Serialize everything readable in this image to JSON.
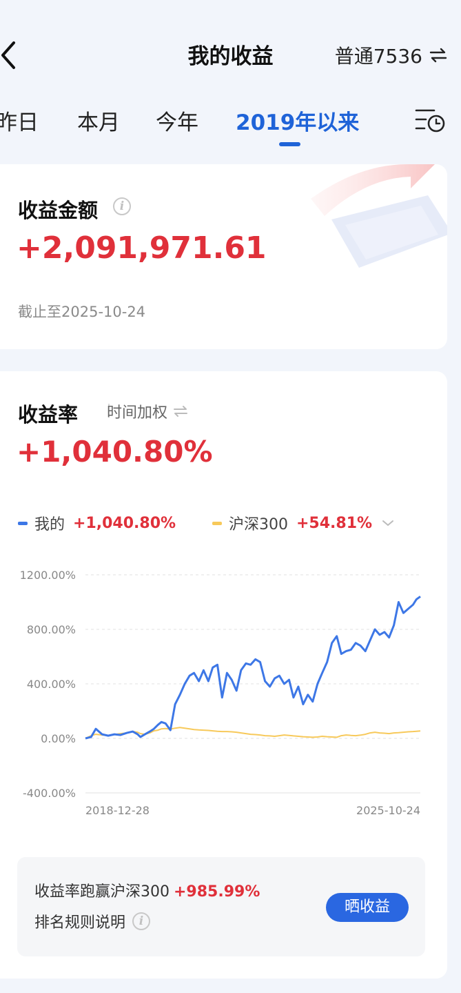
{
  "header": {
    "title": "我的收益",
    "account": "普通7536"
  },
  "tabs": [
    "昨日",
    "本月",
    "今年",
    "2019年以来"
  ],
  "active_tab": 3,
  "profit_amount": {
    "label": "收益金额",
    "value": "+2,091,971.61",
    "as_of": "截止至2025-10-24"
  },
  "return_rate": {
    "label": "收益率",
    "mode": "时间加权",
    "value": "+1,040.80%"
  },
  "legend": {
    "mine": {
      "label": "我的",
      "value": "+1,040.80%",
      "color": "#3d77e6"
    },
    "index": {
      "label": "沪深300",
      "value": "+54.81%",
      "color": "#f7c95a"
    }
  },
  "chart_data": {
    "type": "line",
    "y_ticks": [
      "1200.00%",
      "800.00%",
      "400.00%",
      "0.00%",
      "-400.00%"
    ],
    "ylim": [
      -400,
      1200
    ],
    "x_start_label": "2018-12-28",
    "x_end_label": "2025-10-24",
    "x": [
      "2018-12-28",
      "2019-02-08",
      "2019-03-15",
      "2019-05-01",
      "2019-06-15",
      "2019-08-01",
      "2019-09-15",
      "2019-11-01",
      "2019-12-15",
      "2020-01-20",
      "2020-02-10",
      "2020-03-15",
      "2020-04-20",
      "2020-05-20",
      "2020-06-20",
      "2020-07-15",
      "2020-08-15",
      "2020-09-20",
      "2020-10-25",
      "2020-11-30",
      "2021-01-05",
      "2021-02-10",
      "2021-03-15",
      "2021-04-20",
      "2021-05-25",
      "2021-06-30",
      "2021-08-01",
      "2021-09-05",
      "2021-10-10",
      "2021-11-15",
      "2021-12-20",
      "2022-01-25",
      "2022-02-28",
      "2022-04-05",
      "2022-05-10",
      "2022-06-15",
      "2022-07-20",
      "2022-08-25",
      "2022-09-30",
      "2022-11-05",
      "2022-12-10",
      "2023-01-15",
      "2023-02-20",
      "2023-03-25",
      "2023-04-30",
      "2023-06-05",
      "2023-07-10",
      "2023-08-15",
      "2023-09-20",
      "2023-10-25",
      "2023-11-30",
      "2024-01-05",
      "2024-02-10",
      "2024-03-15",
      "2024-04-20",
      "2024-05-25",
      "2024-06-30",
      "2024-08-05",
      "2024-09-10",
      "2024-10-15",
      "2024-11-20",
      "2024-12-25",
      "2025-01-30",
      "2025-03-05",
      "2025-04-10",
      "2025-05-15",
      "2025-06-20",
      "2025-07-25",
      "2025-08-30",
      "2025-09-25",
      "2025-10-24"
    ],
    "series": [
      {
        "name": "我的",
        "color": "#3d77e6",
        "values": [
          0,
          10,
          70,
          30,
          20,
          30,
          25,
          40,
          50,
          30,
          10,
          30,
          50,
          70,
          100,
          120,
          110,
          60,
          250,
          320,
          400,
          460,
          480,
          420,
          500,
          420,
          520,
          540,
          300,
          480,
          430,
          350,
          500,
          550,
          540,
          580,
          560,
          420,
          380,
          440,
          460,
          400,
          430,
          300,
          380,
          250,
          320,
          270,
          400,
          480,
          560,
          700,
          750,
          620,
          640,
          650,
          700,
          680,
          640,
          720,
          800,
          760,
          780,
          740,
          830,
          1000,
          920,
          950,
          980,
          1020,
          1040.8
        ]
      },
      {
        "name": "沪深300",
        "color": "#f7c95a",
        "values": [
          0,
          20,
          30,
          25,
          22,
          28,
          35,
          40,
          50,
          45,
          35,
          30,
          40,
          55,
          60,
          70,
          72,
          68,
          75,
          80,
          75,
          70,
          65,
          62,
          60,
          58,
          55,
          52,
          50,
          50,
          48,
          45,
          40,
          35,
          30,
          28,
          25,
          20,
          18,
          15,
          20,
          25,
          22,
          18,
          15,
          12,
          10,
          8,
          10,
          15,
          12,
          10,
          8,
          20,
          25,
          22,
          20,
          24,
          30,
          40,
          45,
          40,
          38,
          35,
          40,
          42,
          45,
          48,
          50,
          52,
          54.81
        ]
      }
    ]
  },
  "beat": {
    "label": "收益率跑赢沪深300",
    "value": "+985.99%"
  },
  "rank_rule_label": "排名规则说明",
  "share_button": "晒收益"
}
